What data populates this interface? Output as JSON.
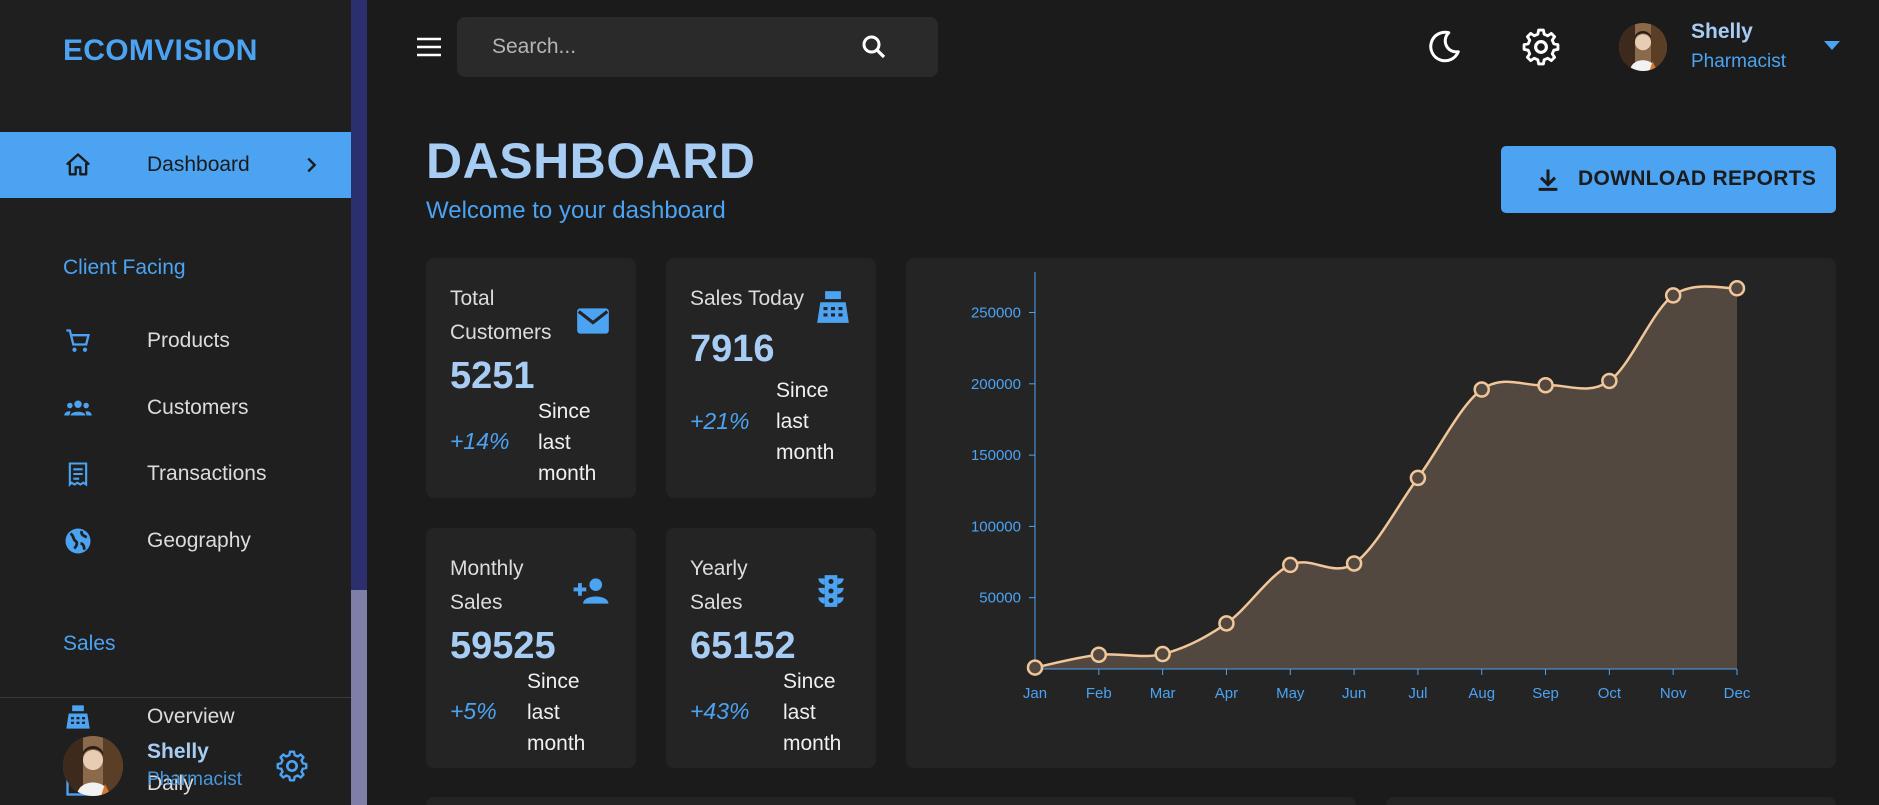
{
  "sidebar": {
    "brand": "ECOMVISION",
    "active_item": {
      "label": "Dashboard",
      "icon": "home-icon"
    },
    "sections": [
      {
        "title": "Client Facing",
        "items": [
          {
            "label": "Products",
            "icon": "shopping-cart-icon"
          },
          {
            "label": "Customers",
            "icon": "group-icon"
          },
          {
            "label": "Transactions",
            "icon": "receipt-icon"
          },
          {
            "label": "Geography",
            "icon": "globe-icon"
          }
        ]
      },
      {
        "title": "Sales",
        "items": [
          {
            "label": "Overview",
            "icon": "point-of-sale-icon"
          },
          {
            "label": "Daily",
            "icon": "calendar-icon"
          }
        ]
      }
    ],
    "footer": {
      "name": "Shelly",
      "role": "Pharmacist"
    }
  },
  "topbar": {
    "search_placeholder": "Search...",
    "user": {
      "name": "Shelly",
      "role": "Pharmacist"
    }
  },
  "header": {
    "title": "DASHBOARD",
    "subtitle": "Welcome to your dashboard",
    "download_label": "DOWNLOAD REPORTS"
  },
  "stats": [
    {
      "title": "Total Customers",
      "value": "5251",
      "increase": "+14%",
      "since": "Since last month",
      "icon": "email-icon"
    },
    {
      "title": "Sales Today",
      "value": "7916",
      "increase": "+21%",
      "since": "Since last month",
      "icon": "point-of-sale-icon"
    },
    {
      "title": "Monthly Sales",
      "value": "59525",
      "increase": "+5%",
      "since": "Since last month",
      "icon": "person-add-icon"
    },
    {
      "title": "Yearly Sales",
      "value": "65152",
      "increase": "+43%",
      "since": "Since last month",
      "icon": "traffic-icon"
    }
  ],
  "colors": {
    "accent": "#4ba3f2",
    "accent_light": "#a8cdf5",
    "line": "#f1c79a",
    "area": "#524840",
    "background": "#1b1b1b",
    "card": "#242424"
  },
  "chart_data": {
    "type": "area",
    "categories": [
      "Jan",
      "Feb",
      "Mar",
      "Apr",
      "May",
      "Jun",
      "Jul",
      "Aug",
      "Sep",
      "Oct",
      "Nov",
      "Dec"
    ],
    "values": [
      1000,
      10000,
      10500,
      32000,
      73000,
      74000,
      134000,
      196000,
      199000,
      202000,
      262000,
      267000
    ],
    "yticks": [
      50000,
      100000,
      150000,
      200000,
      250000
    ],
    "ylim": [
      0,
      270000
    ],
    "title": "",
    "xlabel": "",
    "ylabel": "",
    "grid": false
  }
}
